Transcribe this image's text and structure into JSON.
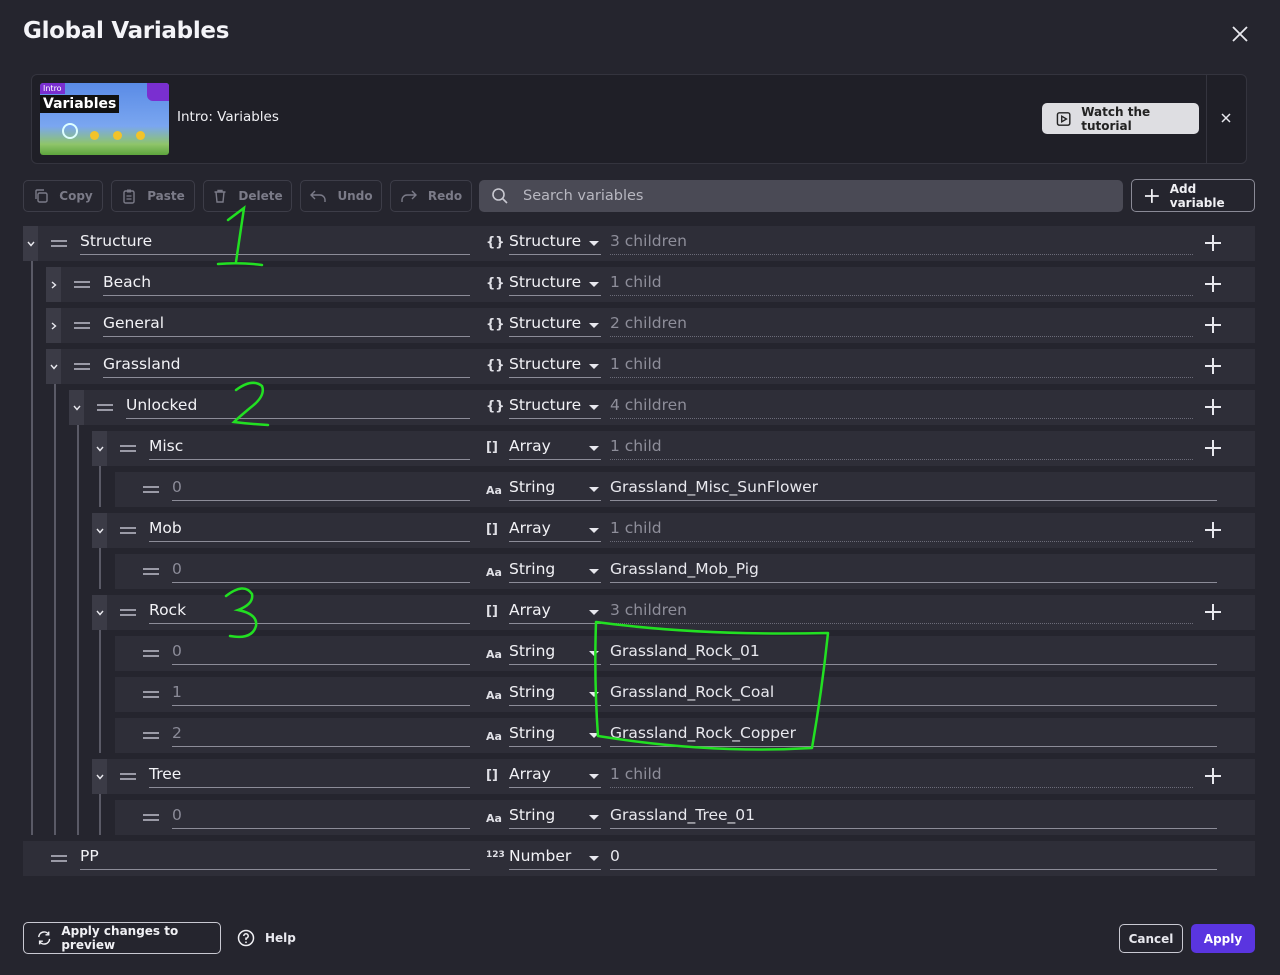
{
  "dialog": {
    "title": "Global Variables"
  },
  "tutorial": {
    "thumb_intro": "Intro",
    "thumb_word": "Variables",
    "label": "Intro: Variables",
    "watch_label": "Watch the tutorial"
  },
  "toolbar": {
    "copy": "Copy",
    "paste": "Paste",
    "delete": "Delete",
    "undo": "Undo",
    "redo": "Redo",
    "search_placeholder": "Search variables",
    "add_variable": "Add variable"
  },
  "rows": [
    {
      "name": "Structure",
      "type": "Structure",
      "type_icon": "{}",
      "value": "3 children",
      "expanded": true
    },
    {
      "name": "Beach",
      "type": "Structure",
      "type_icon": "{}",
      "value": "1 child",
      "expanded": false
    },
    {
      "name": "General",
      "type": "Structure",
      "type_icon": "{}",
      "value": "2 children",
      "expanded": false
    },
    {
      "name": "Grassland",
      "type": "Structure",
      "type_icon": "{}",
      "value": "1 child",
      "expanded": true
    },
    {
      "name": "Unlocked",
      "type": "Structure",
      "type_icon": "{}",
      "value": "4 children",
      "expanded": true
    },
    {
      "name": "Misc",
      "type": "Array",
      "type_icon": "[]",
      "value": "1 child",
      "expanded": true
    },
    {
      "name": "0",
      "type": "String",
      "type_icon": "Aa",
      "value": "Grassland_Misc_SunFlower"
    },
    {
      "name": "Mob",
      "type": "Array",
      "type_icon": "[]",
      "value": "1 child",
      "expanded": true
    },
    {
      "name": "0",
      "type": "String",
      "type_icon": "Aa",
      "value": "Grassland_Mob_Pig"
    },
    {
      "name": "Rock",
      "type": "Array",
      "type_icon": "[]",
      "value": "3 children",
      "expanded": true
    },
    {
      "name": "0",
      "type": "String",
      "type_icon": "Aa",
      "value": "Grassland_Rock_01"
    },
    {
      "name": "1",
      "type": "String",
      "type_icon": "Aa",
      "value": "Grassland_Rock_Coal"
    },
    {
      "name": "2",
      "type": "String",
      "type_icon": "Aa",
      "value": "Grassland_Rock_Copper"
    },
    {
      "name": "Tree",
      "type": "Array",
      "type_icon": "[]",
      "value": "1 child",
      "expanded": true
    },
    {
      "name": "0",
      "type": "String",
      "type_icon": "Aa",
      "value": "Grassland_Tree_01"
    },
    {
      "name": "PP",
      "type": "Number",
      "type_icon": "123",
      "value": "0"
    }
  ],
  "footer": {
    "apply_preview": "Apply changes to preview",
    "help": "Help",
    "cancel": "Cancel",
    "apply": "Apply"
  },
  "colors": {
    "background": "#25252e",
    "row_bg": "#2e2e38",
    "accent": "#5a35e0",
    "annotation": "#22e022"
  }
}
